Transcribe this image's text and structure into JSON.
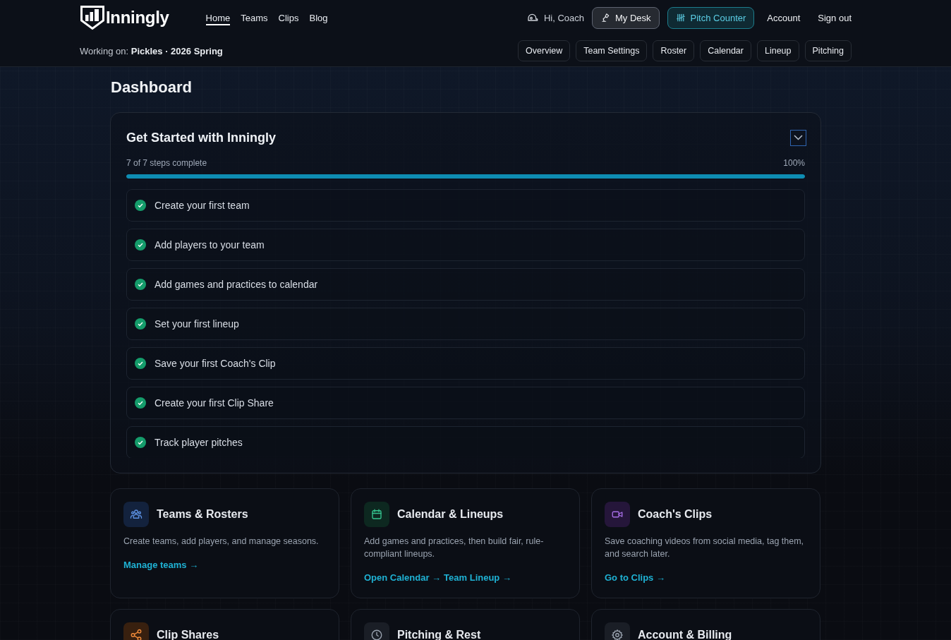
{
  "header": {
    "logo": "Inningly",
    "nav": [
      {
        "label": "Home",
        "selected": true
      },
      {
        "label": "Teams",
        "selected": false
      },
      {
        "label": "Clips",
        "selected": false
      },
      {
        "label": "Blog",
        "selected": false
      }
    ],
    "greeting": "Hi, Coach",
    "buttons": [
      {
        "label": "My Desk",
        "kind": "desk"
      },
      {
        "label": "Pitch Counter",
        "kind": "pitch"
      }
    ],
    "links": [
      "Account",
      "Sign out"
    ],
    "context": "Working on: **Pickles · 2026 Spring**",
    "subnav": [
      {
        "label": "Overview",
        "selected": false
      },
      {
        "label": "Team Settings",
        "selected": false
      },
      {
        "label": "Roster",
        "selected": false
      },
      {
        "label": "Calendar",
        "selected": false
      },
      {
        "label": "Lineup",
        "selected": false
      },
      {
        "label": "Pitching",
        "selected": false
      }
    ]
  },
  "page_title": "Dashboard",
  "get_started": {
    "title": "Get Started with Inningly",
    "progress": {
      "label": "7 of 7 steps complete",
      "percent": "100%",
      "level": 1
    },
    "steps": [
      {
        "label": "Create your first team",
        "checked": true
      },
      {
        "label": "Add players to your team",
        "checked": true
      },
      {
        "label": "Add games and practices to calendar",
        "checked": true
      },
      {
        "label": "Set your first lineup",
        "checked": true
      },
      {
        "label": "Save your first Coach's Clip",
        "checked": true
      },
      {
        "label": "Create your first Clip Share",
        "checked": true
      },
      {
        "label": "Track player pitches",
        "checked": true
      }
    ]
  },
  "cards": [
    {
      "kind": "teams",
      "title": "Teams & Rosters",
      "description": "Create teams, add players, and manage seasons.",
      "links": [
        "Manage teams →"
      ]
    },
    {
      "kind": "calendar",
      "title": "Calendar & Lineups",
      "description": "Add games and practices, then build fair, rule-compliant lineups.",
      "links": [
        "Open Calendar →",
        "Team Lineup →"
      ]
    },
    {
      "kind": "clips",
      "title": "Coach's Clips",
      "description": "Save coaching videos from social media, tag them, and search later.",
      "links": [
        "Go to Clips →"
      ]
    },
    {
      "kind": "shares",
      "title": "Clip Shares"
    },
    {
      "kind": "pitching",
      "title": "Pitching & Rest"
    },
    {
      "kind": "account",
      "title": "Account & Billing"
    }
  ]
}
